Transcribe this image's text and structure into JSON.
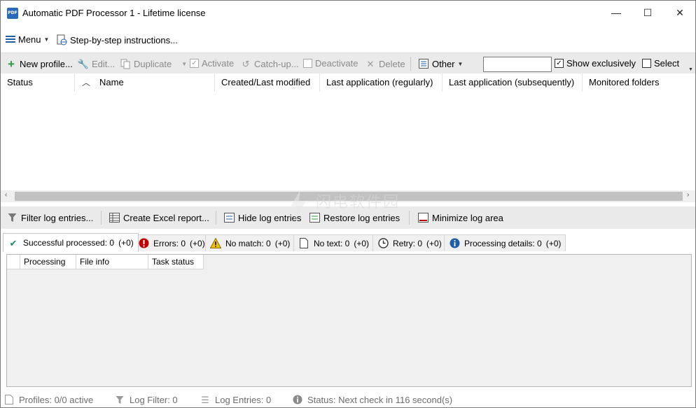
{
  "window": {
    "title": "Automatic PDF Processor 1 - Lifetime license",
    "app_icon_text": "PDF",
    "minimize_glyph": "—",
    "maximize_glyph": "☐",
    "close_glyph": "✕"
  },
  "menubar": {
    "menu_label": "Menu",
    "instructions_label": "Step-by-step instructions..."
  },
  "toolbar": {
    "new_profile": "New profile...",
    "edit": "Edit...",
    "duplicate": "Duplicate",
    "activate": "Activate",
    "catch_up": "Catch-up...",
    "deactivate": "Deactivate",
    "delete": "Delete",
    "other": "Other",
    "search_value": "",
    "show_exclusively": "Show exclusively",
    "select": "Select"
  },
  "profiles_table": {
    "columns": [
      "Status",
      "Name",
      "Created/Last modified",
      "Last application (regularly)",
      "Last application (subsequently)",
      "Monitored folders"
    ]
  },
  "log_toolbar": {
    "filter": "Filter log entries...",
    "excel": "Create Excel report...",
    "hide": "Hide log entries",
    "restore": "Restore log entries",
    "minimize": "Minimize log area"
  },
  "log_tabs": [
    {
      "label": "Successful processed: 0",
      "delta": "(+0)",
      "icon": "check-icon"
    },
    {
      "label": "Errors: 0",
      "delta": "(+0)",
      "icon": "error-icon"
    },
    {
      "label": "No match: 0",
      "delta": "(+0)",
      "icon": "warning-icon"
    },
    {
      "label": "No text: 0",
      "delta": "(+0)",
      "icon": "document-icon"
    },
    {
      "label": "Retry: 0",
      "delta": "(+0)",
      "icon": "clock-icon"
    },
    {
      "label": "Processing details: 0",
      "delta": "(+0)",
      "icon": "info-icon"
    }
  ],
  "log_table": {
    "columns": [
      "Processing",
      "File info",
      "Task status"
    ]
  },
  "statusbar": {
    "profiles": "Profiles: 0/0 active",
    "log_filter": "Log Filter: 0",
    "log_entries": "Log Entries: 0",
    "status": "Status: Next check in 116 second(s)"
  },
  "watermark": {
    "text": "闪电软件园"
  },
  "colors": {
    "accent_blue": "#1f5fa8",
    "green_plus": "#2e9a3c",
    "error_red": "#c00000",
    "warning_yellow": "#f2c200",
    "check_teal": "#1a8a6a"
  }
}
